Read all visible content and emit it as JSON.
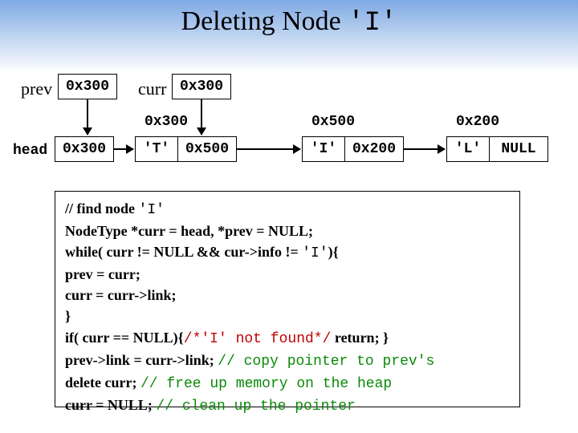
{
  "title": {
    "plain": "Deleting Node ",
    "mono": "'I'"
  },
  "pointers": {
    "prev_label": "prev",
    "prev_value": "0x300",
    "curr_label": "curr",
    "curr_value": "0x300",
    "head_label": "head",
    "head_value": "0x300"
  },
  "nodes": [
    {
      "addr": "0x300",
      "info": "'T'",
      "link": "0x500"
    },
    {
      "addr": "0x500",
      "info": "'I'",
      "link": "0x200"
    },
    {
      "addr": "0x200",
      "info": "'L'",
      "link": "NULL"
    }
  ],
  "code": {
    "l1a": "// find node ",
    "l1b": "'I'",
    "l2": "NodeType *curr = head,  *prev = NULL;",
    "l3a": "while( curr != NULL  &&  cur->info != ",
    "l3b": "'I'",
    "l3c": "){",
    "l4": "  prev = curr;",
    "l5": "  curr = curr->link;",
    "l6": "}",
    "l7a": "if( curr == NULL){",
    "l7b": "/*'I' not found*/",
    "l7c": " return; }",
    "l8a": "prev->link = curr->link; ",
    "l8b": "// copy pointer to prev's",
    "l9a": "delete curr; ",
    "l9b": "// free up memory on the heap",
    "l10a": "curr = NULL; ",
    "l10b": "// clean up the pointer"
  }
}
